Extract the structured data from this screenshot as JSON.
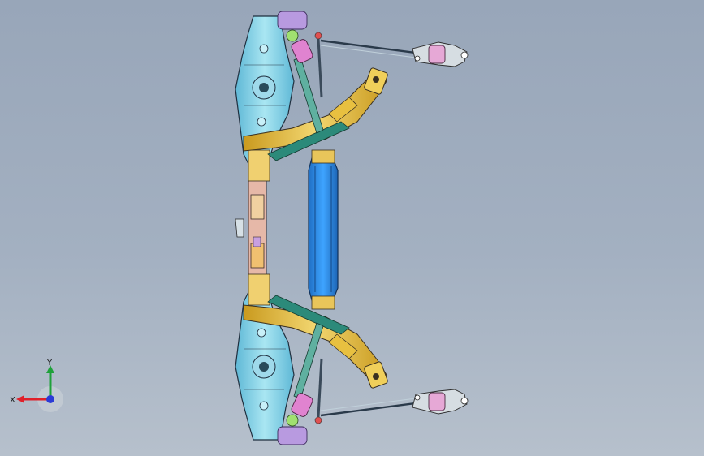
{
  "viewport": {
    "background_top": "#98a6b9",
    "background_bottom": "#b6c0cc"
  },
  "colors": {
    "subframe_beam": "#2f8fe6",
    "knuckle": "#7fd3e8",
    "control_arm": "#e7c24c",
    "trailing_link": "#2c8a7a",
    "bushing": "#d98fd0",
    "outline": "#1f2f3f"
  },
  "triad": {
    "x_label": "X",
    "y_label": "Y",
    "x_color": "#e0202a",
    "y_color": "#1ea13a",
    "z_color": "#2b3bd6"
  },
  "icons": [
    "coordinate-triad-icon"
  ]
}
